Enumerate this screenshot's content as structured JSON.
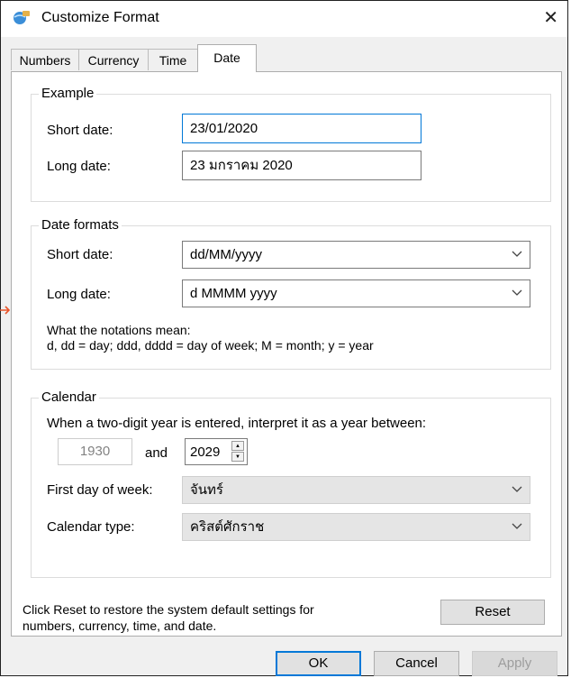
{
  "window": {
    "title": "Customize Format",
    "close_glyph": "✕"
  },
  "tabs": [
    {
      "label": "Numbers",
      "active": false
    },
    {
      "label": "Currency",
      "active": false
    },
    {
      "label": "Time",
      "active": false
    },
    {
      "label": "Date",
      "active": true
    }
  ],
  "example": {
    "group_title": "Example",
    "short_label": "Short date:",
    "short_value": "23/01/2020",
    "long_label": "Long date:",
    "long_value": "23 มกราคม 2020"
  },
  "formats": {
    "group_title": "Date formats",
    "short_label": "Short date:",
    "short_value": "dd/MM/yyyy",
    "long_label": "Long date:",
    "long_value": "d MMMM yyyy",
    "notation_title": "What the notations mean:",
    "notation_text": "d, dd = day;  ddd, dddd = day of week;  M = month;  y = year"
  },
  "calendar": {
    "group_title": "Calendar",
    "two_digit_text": "When a two-digit year is entered, interpret it as a year between:",
    "from_year": "1930",
    "and_label": "and",
    "to_year": "2029",
    "first_day_label": "First day of week:",
    "first_day_value": "จันทร์",
    "type_label": "Calendar type:",
    "type_value": "คริสต์ศักราช"
  },
  "footer": {
    "reset_text_line1": "Click Reset to restore the system default settings for",
    "reset_text_line2": "numbers, currency, time, and date.",
    "reset_label": "Reset"
  },
  "buttons": {
    "ok": "OK",
    "cancel": "Cancel",
    "apply": "Apply"
  },
  "colors": {
    "focus_border": "#0078d7",
    "window_bg": "#f0f0f0",
    "annotation_arrow": "#e8542a"
  }
}
